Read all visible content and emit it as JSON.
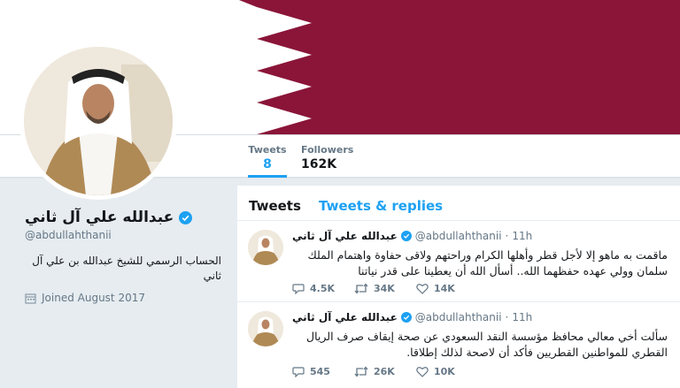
{
  "profile": {
    "name": "عبدالله علي آل ثاني",
    "handle": "@abdullahthanii",
    "bio": "الحساب الرسمي للشيخ عبدالله بن علي آل ثاني",
    "joined": "Joined August 2017"
  },
  "nav": {
    "tweets_label": "Tweets",
    "tweets_count": "8",
    "followers_label": "Followers",
    "followers_count": "162K"
  },
  "timeline": {
    "tab_tweets": "Tweets",
    "tab_replies": "Tweets & replies",
    "tweets": [
      {
        "name": "عبدالله علي آل ثاني",
        "handle": "@abdullahthanii",
        "dot": "·",
        "time": "11h",
        "text": "ماقمت به ماهو إلا لأجل قطر وأهلها الكرام وراحتهم ولاقى حفاوة واهتمام الملك سلمان وولي عهده حفظهما الله.. أسأل الله أن يعطينا على قدر نياتنا",
        "replies": "4.5K",
        "retweets": "34K",
        "likes": "14K"
      },
      {
        "name": "عبدالله علي آل ثاني",
        "handle": "@abdullahthanii",
        "dot": "·",
        "time": "11h",
        "text": "سألت أخي معالي محافظ مؤسسة النقد السعودي عن صحة إيقاف صرف الريال القطري للمواطنين القطريين فأكد أن لاصحة لذلك إطلاقا.",
        "replies": "545",
        "retweets": "26K",
        "likes": "10K"
      }
    ]
  },
  "colors": {
    "maroon": "#8a1538",
    "accent": "#1da1f2",
    "muted": "#657786"
  }
}
